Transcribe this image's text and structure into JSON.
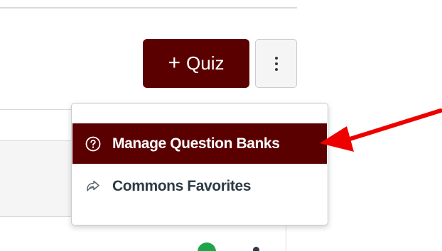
{
  "toolbar": {
    "add_quiz_plus": "+",
    "add_quiz_label": "Quiz"
  },
  "menu": {
    "items": [
      {
        "label": "Manage Question Banks",
        "icon": "question-circle-icon",
        "active": true
      },
      {
        "label": "Commons Favorites",
        "icon": "commons-share-icon",
        "active": false
      }
    ]
  },
  "colors": {
    "brand": "#5b0000",
    "annotation_arrow": "#ee0000",
    "status_green": "#1ca54a"
  }
}
